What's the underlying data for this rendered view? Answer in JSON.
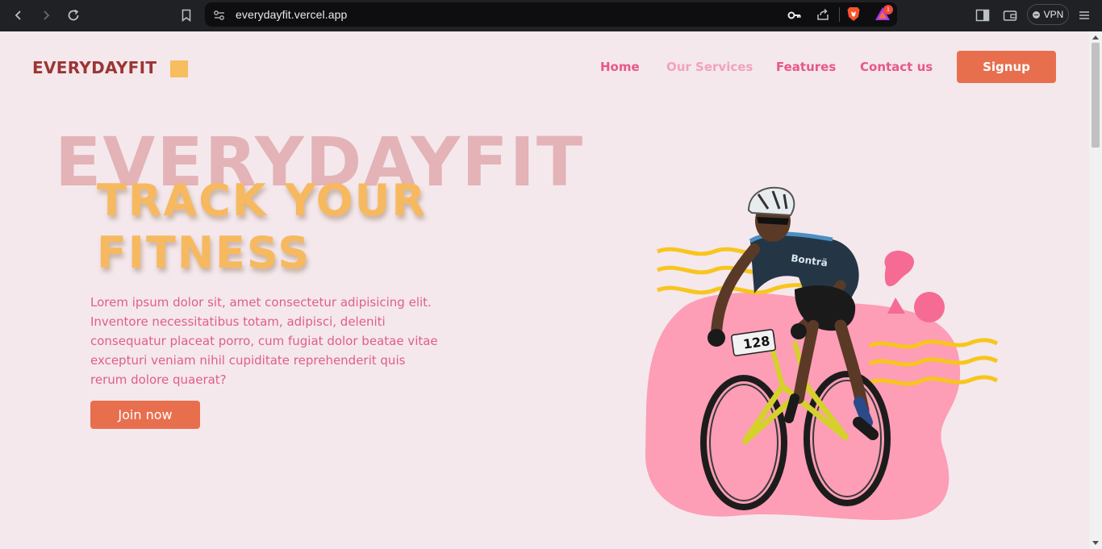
{
  "browser": {
    "url": "everydayfit.vercel.app",
    "vpn_label": "VPN",
    "notification_count": "1"
  },
  "brand": {
    "logo_text": "EVERYDAYFIT",
    "accent": "#f7bd5e",
    "primary": "#e86f4e",
    "pink": "#e8578a"
  },
  "nav": {
    "items": [
      {
        "label": "Home"
      },
      {
        "label": "Our Services"
      },
      {
        "label": "Features"
      },
      {
        "label": "Contact us"
      }
    ],
    "signup_label": "Signup"
  },
  "hero": {
    "background_word": "EVERYDAYFIT",
    "headline_line1": "TRACK YOUR",
    "headline_line2": "FITNESS",
    "paragraph": " Lorem ipsum dolor sit, amet consectetur adipisicing elit. Inventore necessitatibus totam, adipisci, deleniti consequatur placeat porro, cum fugiat dolor beatae vitae excepturi veniam nihil cupiditate reprehenderit quis rerum dolore quaerat?",
    "cta_label": "Join now",
    "bib_number": "128",
    "jersey_text": "Bonträ"
  }
}
